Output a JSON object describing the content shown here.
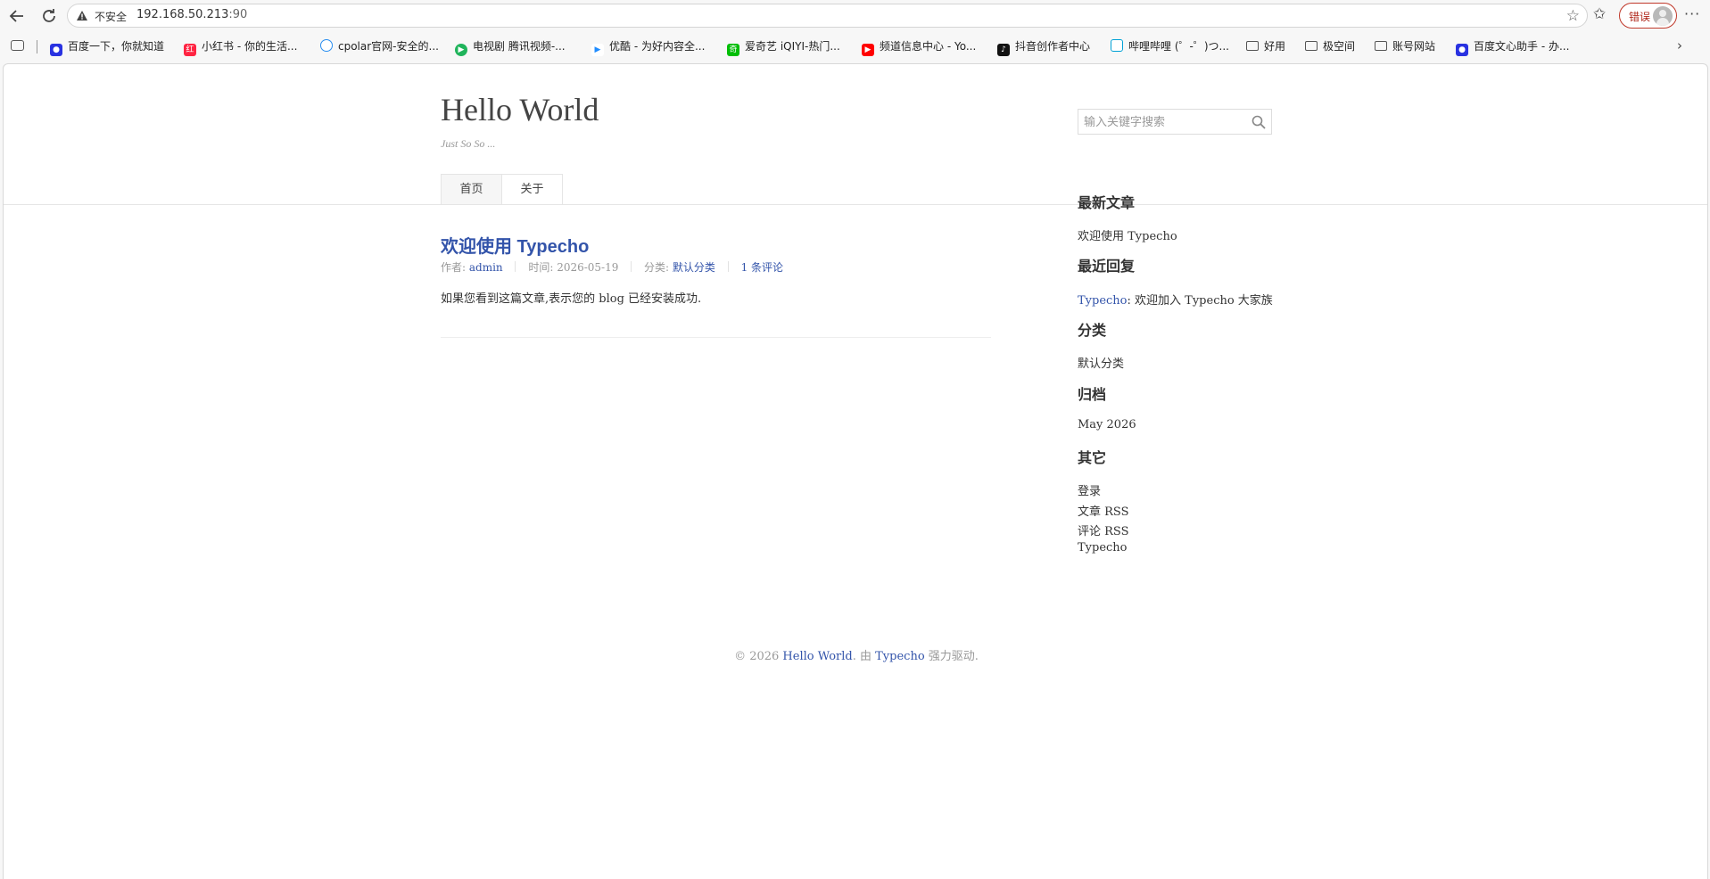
{
  "browser": {
    "insecure_label": "不安全",
    "url_host": "192.168.50.213",
    "url_port": ":90",
    "error_label": "错误",
    "bookmarks": [
      {
        "label": "百度一下，你就知道",
        "icon": "baidu-icon",
        "color": "#2932e1"
      },
      {
        "label": "小红书 - 你的生活...",
        "icon": "xiaohongshu-icon",
        "color": "#ff2442"
      },
      {
        "label": "cpolar官网-安全的...",
        "icon": "cpolar-icon",
        "color": "#2a8ef0"
      },
      {
        "label": "电视剧 腾讯视频-...",
        "icon": "tencent-video-icon",
        "color": "#20b45b"
      },
      {
        "label": "优酷 - 为好内容全...",
        "icon": "youku-icon",
        "color": "#1f8cff"
      },
      {
        "label": "爱奇艺 iQIYI-热门...",
        "icon": "iqiyi-icon",
        "color": "#00be06"
      },
      {
        "label": "频道信息中心 - Yo...",
        "icon": "youtube-icon",
        "color": "#ff0000"
      },
      {
        "label": "抖音创作者中心",
        "icon": "douyin-icon",
        "color": "#111111"
      },
      {
        "label": "哔哩哔哩 (゜-゜)つ...",
        "icon": "bilibili-icon",
        "color": "#00a1d6"
      },
      {
        "label": "好用",
        "icon": "folder-icon"
      },
      {
        "label": "极空间",
        "icon": "folder-icon"
      },
      {
        "label": "账号网站",
        "icon": "folder-icon"
      },
      {
        "label": "百度文心助手 - 办...",
        "icon": "baidu-icon",
        "color": "#2932e1"
      }
    ]
  },
  "site": {
    "title": "Hello World",
    "description": "Just So So ...",
    "search_placeholder": "输入关键字搜索",
    "nav": [
      "首页",
      "关于"
    ]
  },
  "post": {
    "title": "欢迎使用 Typecho",
    "author_label": "作者:",
    "author": "admin",
    "time_label": "时间:",
    "time": "2026-05-19",
    "category_label": "分类:",
    "category": "默认分类",
    "comments": "1 条评论",
    "body": "如果您看到这篇文章,表示您的 blog 已经安装成功."
  },
  "sidebar": {
    "recent_posts_title": "最新文章",
    "recent_posts": [
      "欢迎使用 Typecho"
    ],
    "recent_comments_title": "最近回复",
    "recent_comment_author": "Typecho",
    "recent_comment_text": ": 欢迎加入 Typecho 大家族",
    "categories_title": "分类",
    "categories": [
      "默认分类"
    ],
    "archives_title": "归档",
    "archives": [
      "May 2026"
    ],
    "other_title": "其它",
    "other_links": [
      "登录",
      "文章 RSS",
      "评论 RSS",
      "Typecho"
    ]
  },
  "footer": {
    "copyright": "© 2026",
    "site_link": "Hello World",
    "by": ". 由",
    "powered_link": "Typecho",
    "powered": "强力驱动."
  }
}
